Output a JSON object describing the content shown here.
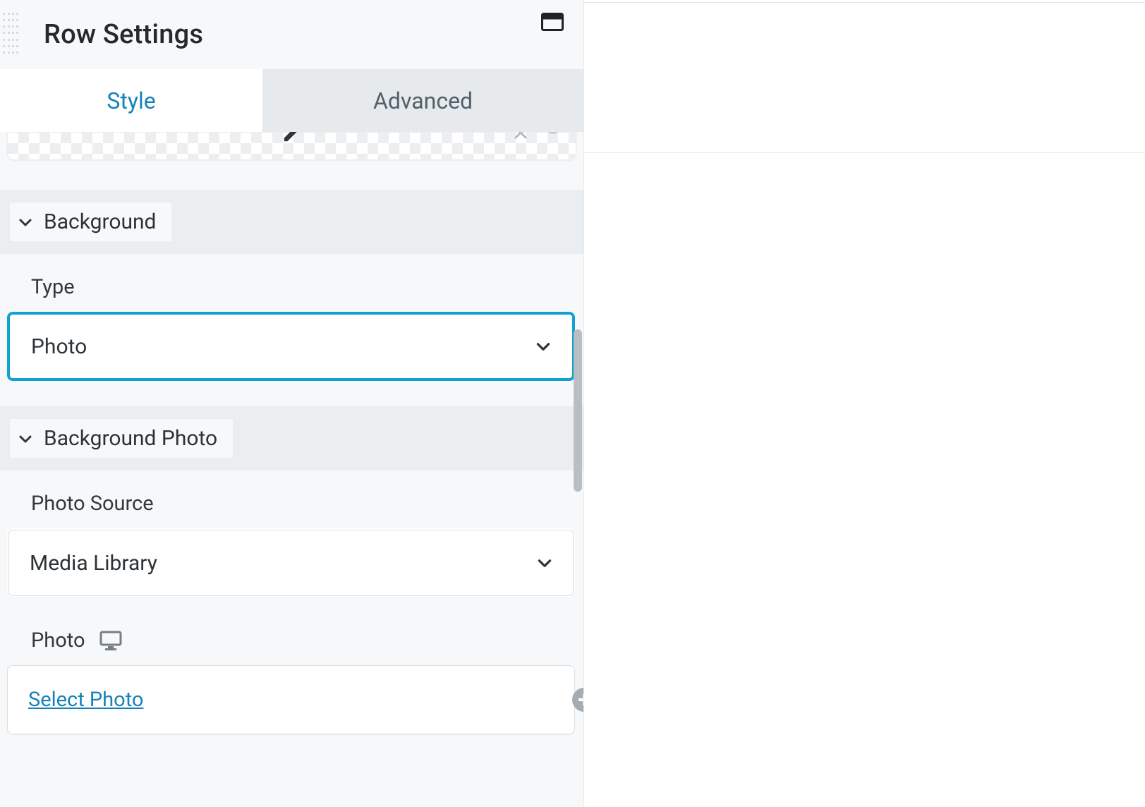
{
  "header": {
    "title": "Row Settings"
  },
  "tabs": {
    "style": "Style",
    "advanced": "Advanced",
    "active": "style"
  },
  "sections": {
    "background": {
      "title": "Background",
      "type_label": "Type",
      "type_value": "Photo"
    },
    "background_photo": {
      "title": "Background Photo",
      "source_label": "Photo Source",
      "source_value": "Media Library",
      "photo_label": "Photo",
      "select_photo": "Select Photo"
    }
  }
}
